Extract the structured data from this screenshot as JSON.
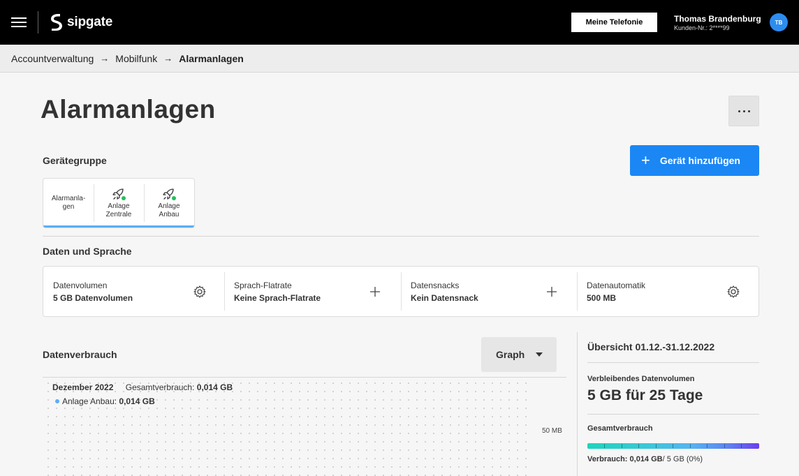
{
  "header": {
    "logo_text": "sipgate",
    "telephony_button": "Meine Telefonie",
    "user_name": "Thomas Brandenburg",
    "customer_nr": "Kunden-Nr.: 2****99",
    "avatar_initials": "TB"
  },
  "breadcrumb": {
    "items": [
      "Accountverwaltung",
      "Mobilfunk"
    ],
    "current": "Alarmanlagen"
  },
  "page": {
    "title": "Alarmanlagen"
  },
  "device_group": {
    "label": "Gerätegruppe",
    "add_button": "Gerät hinzufügen",
    "items": [
      {
        "label": "Alarmanla-\ngen"
      },
      {
        "label": "Anlage\nZentrale"
      },
      {
        "label": "Anlage\nAnbau"
      }
    ]
  },
  "data_language": {
    "label": "Daten und Sprache",
    "cells": [
      {
        "label": "Datenvolumen",
        "value": "5 GB Datenvolumen",
        "action_icon": "gear-icon"
      },
      {
        "label": "Sprach-Flatrate",
        "value": "Keine Sprach-Flatrate",
        "action_icon": "plus-icon"
      },
      {
        "label": "Datensnacks",
        "value": "Kein Datensnack",
        "action_icon": "plus-icon"
      },
      {
        "label": "Datenautomatik",
        "value": "500 MB",
        "action_icon": "gear-icon"
      }
    ]
  },
  "usage": {
    "label": "Datenverbrauch",
    "view_select": "Graph",
    "month": "Dezember 2022",
    "total_prefix": "Gesamtverbrauch:",
    "total_value": "0,014 GB",
    "legend_name": "Anlage Anbau:",
    "legend_value": "0,014 GB",
    "tick_label": "50 MB"
  },
  "overview": {
    "title": "Übersicht 01.12.-31.12.2022",
    "remaining_label": "Verbleibendes Datenvolumen",
    "remaining_value": "5 GB für 25 Tage",
    "total_label": "Gesamtverbrauch",
    "usage_prefix": "Verbrauch: 0,014 GB",
    "usage_suffix": "/ 5 GB (0%)",
    "usage_fraction": 0.0
  },
  "colors": {
    "brand_blue": "#1a87f5",
    "online_dot": "#21c05a",
    "topbar": "#000000"
  }
}
